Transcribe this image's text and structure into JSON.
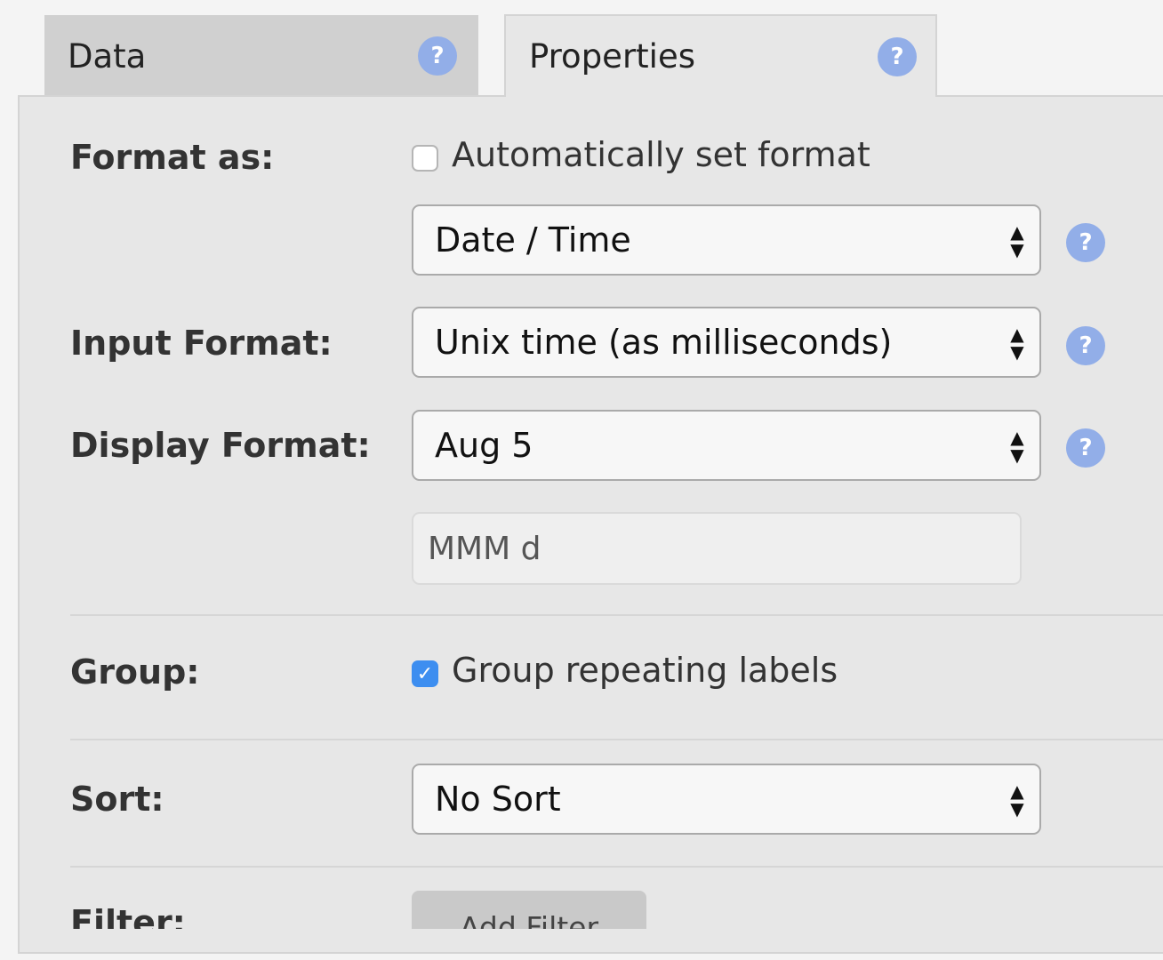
{
  "tabs": [
    {
      "label": "Data",
      "active": false
    },
    {
      "label": "Properties",
      "active": true
    }
  ],
  "help_glyph": "?",
  "format_as": {
    "label": "Format as:",
    "auto_checkbox_label": "Automatically set format",
    "auto_checked": false,
    "selected": "Date / Time"
  },
  "input_format": {
    "label": "Input Format:",
    "selected": "Unix time (as milliseconds)"
  },
  "display_format": {
    "label": "Display Format:",
    "selected": "Aug 5",
    "pattern_value": "MMM d"
  },
  "group": {
    "label": "Group:",
    "checkbox_label": "Group repeating labels",
    "checked": true,
    "check_glyph": "✓"
  },
  "sort": {
    "label": "Sort:",
    "selected": "No Sort"
  },
  "filter": {
    "label": "Filter:",
    "add_button_label": "Add Filter"
  },
  "select_arrows": {
    "up": "▲",
    "down": "▼"
  },
  "colors": {
    "help_icon": "#92aee8",
    "checkbox_checked": "#3d8ef0",
    "panel_bg": "#e7e7e7",
    "inactive_tab_bg": "#d0d0d0"
  }
}
